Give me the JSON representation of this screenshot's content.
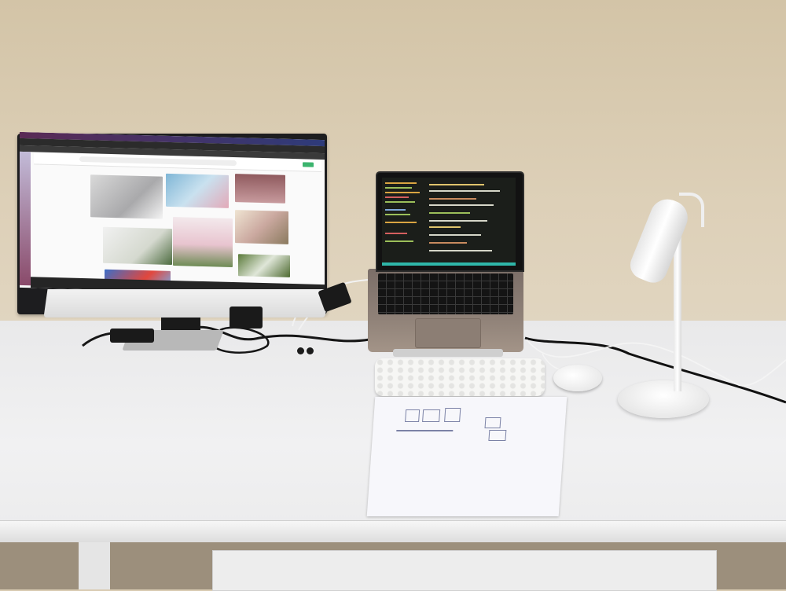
{
  "scene": {
    "description_items": [
      "monitor",
      "laptop",
      "keyboard",
      "mouse",
      "lamp",
      "paper"
    ],
    "colors": {
      "wall": "#d3c4a7",
      "desk": "#eeeeee",
      "monitor_frame": "#1d1d1f",
      "lamp": "#f5f5f5",
      "terminal_status": "#2fb6a9"
    }
  }
}
